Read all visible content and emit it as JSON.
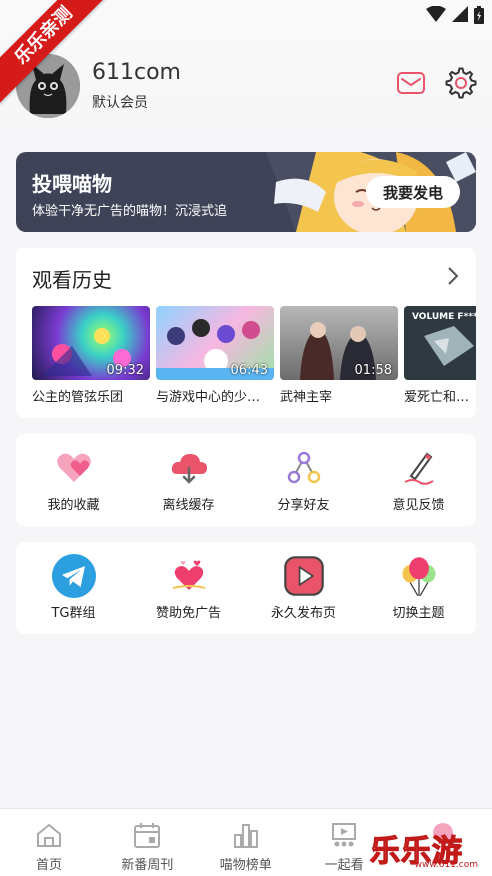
{
  "ribbon": {
    "text": "乐乐亲测"
  },
  "profile": {
    "username": "611com",
    "member_level": "默认会员"
  },
  "banner": {
    "title": "投喂喵物",
    "subtitle": "体验干净无广告的喵物！沉浸式追",
    "button": "我要发电"
  },
  "history": {
    "title": "观看历史",
    "items": [
      {
        "title": "公主的管弦乐团",
        "time": "09:32"
      },
      {
        "title": "与游戏中心的少…",
        "time": "06:43"
      },
      {
        "title": "武神主宰",
        "time": "01:58"
      },
      {
        "title": "爱死亡和机器",
        "time": ""
      }
    ],
    "thumb4_caption": "VOLUME F***"
  },
  "actions_row1": [
    {
      "label": "我的收藏",
      "icon": "heart-icon"
    },
    {
      "label": "离线缓存",
      "icon": "cloud-download-icon"
    },
    {
      "label": "分享好友",
      "icon": "share-icon"
    },
    {
      "label": "意见反馈",
      "icon": "pencil-icon"
    }
  ],
  "actions_row2": [
    {
      "label": "TG群组",
      "icon": "telegram-icon"
    },
    {
      "label": "赞助免广告",
      "icon": "hearts-icon"
    },
    {
      "label": "永久发布页",
      "icon": "play-icon"
    },
    {
      "label": "切换主题",
      "icon": "balloons-icon"
    }
  ],
  "bottom_nav": [
    {
      "label": "首页",
      "icon": "home-icon"
    },
    {
      "label": "新番周刊",
      "icon": "calendar-icon"
    },
    {
      "label": "喵物榜单",
      "icon": "ranking-icon"
    },
    {
      "label": "一起看",
      "icon": "theater-icon"
    },
    {
      "label": "",
      "icon": "me-icon"
    }
  ],
  "watermark": {
    "main": "乐乐游戏",
    "sub": "www.611.com"
  },
  "colors": {
    "accent": "#e9546b",
    "banner_bg": "#3f4357",
    "ribbon": "#d51a1a"
  }
}
